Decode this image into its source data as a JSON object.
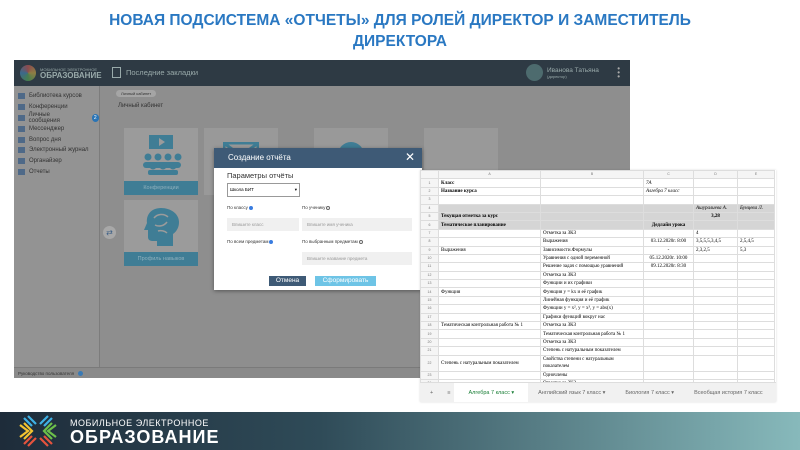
{
  "slide_title": [
    "НОВАЯ ПОДСИСТЕМА «ОТЧЕТЫ» ДЛЯ РОЛЕЙ ДИРЕКТОР И ЗАМЕСТИТЕЛЬ",
    "ДИРЕКТОРА"
  ],
  "app": {
    "logo": {
      "line1": "МОБИЛЬНОЕ ЭЛЕКТРОННОЕ",
      "line2": "ОБРАЗОВАНИЕ"
    },
    "bookmarks": "Последние закладки",
    "user": {
      "name": "Иванова Татьяна",
      "role": "(директор)"
    },
    "sidebar": [
      {
        "label": "Библиотека курсов"
      },
      {
        "label": "Конференции"
      },
      {
        "label": "Личные сообщения",
        "badge": "2"
      },
      {
        "label": "Мессенджер"
      },
      {
        "label": "Вопрос дня"
      },
      {
        "label": "Электронный журнал"
      },
      {
        "label": "Органайзер"
      },
      {
        "label": "Отчеты"
      }
    ],
    "breadcrumb": "Личный кабинет",
    "page_title": "Личный кабинет",
    "cards": [
      "Конференции",
      "Профиль навыков"
    ],
    "footer": "Руководство пользователя"
  },
  "modal": {
    "title": "Создание отчёта",
    "close": "✕",
    "params_label": "Параметры отчёты",
    "school_select": "Школа БИТ",
    "by_class": "По классу",
    "by_student": "По ученику",
    "class_placeholder": "Впишите класс",
    "student_placeholder": "Впишите имя ученика",
    "all_subjects": "По всем предметам",
    "selected_subjects": "По выбранным предметам",
    "subject_placeholder": "Впишите название предмета",
    "cancel": "Отмена",
    "submit": "Сформировать"
  },
  "sheet": {
    "columns": [
      "A",
      "B",
      "C",
      "D",
      "E"
    ],
    "rows": [
      {
        "n": "1",
        "cells": [
          "Класс",
          "",
          "7А",
          "",
          ""
        ]
      },
      {
        "n": "2",
        "cells": [
          "Название курса",
          "",
          "Алгебра 7 класс",
          "",
          ""
        ]
      },
      {
        "n": "3",
        "cells": [
          "",
          "",
          "",
          "",
          ""
        ]
      },
      {
        "n": "4",
        "cells": [
          "",
          "",
          "",
          "Ашуралиева А.",
          "Бунцева Л."
        ],
        "gray": true
      },
      {
        "n": "5",
        "cells": [
          "Текущая отметка за курс",
          "",
          "",
          "3,28",
          ""
        ],
        "gray": true
      },
      {
        "n": "6",
        "cells": [
          "Тематическое планирование",
          "",
          "Дедлайн урока",
          "",
          ""
        ],
        "gray": true
      },
      {
        "n": "7",
        "cells": [
          "",
          "Отметка за ЗКЗ",
          "",
          "4",
          ""
        ]
      },
      {
        "n": "8",
        "cells": [
          "",
          "Выражения",
          "03.12.2020г. 8:00",
          "3,5,5,5,3,4,5",
          "2,5,4,5"
        ]
      },
      {
        "n": "9",
        "cells": [
          "Выражения",
          "Зависимости.Формулы",
          "-",
          "2,3,2,5",
          "5,3"
        ]
      },
      {
        "n": "10",
        "cells": [
          "",
          "Уравнения с одной переменной",
          "05.12.2020г. 10:00",
          "",
          ""
        ]
      },
      {
        "n": "11",
        "cells": [
          "",
          "Решение задач с помощью уравнений",
          "09.12.2020г. 8:30",
          "",
          ""
        ]
      },
      {
        "n": "12",
        "cells": [
          "",
          "Отметка за ЗКЗ",
          "",
          "",
          ""
        ]
      },
      {
        "n": "13",
        "cells": [
          "",
          "Функции и их графики",
          "",
          "",
          ""
        ]
      },
      {
        "n": "14",
        "cells": [
          "Функция",
          "Функция y = kx и её график",
          "",
          "",
          ""
        ]
      },
      {
        "n": "15",
        "cells": [
          "",
          "Линейная функция и её график",
          "",
          "",
          ""
        ]
      },
      {
        "n": "16",
        "cells": [
          "",
          "Функции y = x², y = x³, y = abs(x)",
          "",
          "",
          ""
        ]
      },
      {
        "n": "17",
        "cells": [
          "",
          "Графики функций вокруг нас",
          "",
          "",
          ""
        ]
      },
      {
        "n": "18",
        "cells": [
          "Тематическая контрольная работа  № 1",
          "Отметка за ЗКЗ",
          "",
          "",
          ""
        ]
      },
      {
        "n": "19",
        "cells": [
          "",
          "Тематическая контрольная работа № 1",
          "",
          "",
          ""
        ]
      },
      {
        "n": "20",
        "cells": [
          "",
          "Отметка за ЗКЗ",
          "",
          "",
          ""
        ]
      },
      {
        "n": "21",
        "cells": [
          "",
          "Степень с натуральным показателем",
          "",
          "",
          ""
        ]
      },
      {
        "n": "22",
        "cells": [
          "Степень с натуральным показателем",
          "Свойства степени с натуральным показателем",
          "",
          "",
          ""
        ]
      },
      {
        "n": "23",
        "cells": [
          "",
          "Одночлены",
          "",
          "",
          ""
        ]
      },
      {
        "n": "24",
        "cells": [
          "",
          "Отметка за ЗКЗ",
          "",
          "",
          ""
        ]
      }
    ],
    "tabs": [
      "Алгебра 7 класс",
      "Английский язык 7 класс",
      "Биология 7 класс",
      "Всеобщая история 7 класс"
    ],
    "add_sheet": "+",
    "all_sheets": "≡"
  },
  "banner": {
    "line1": "МОБИЛЬНОЕ ЭЛЕКТРОННОЕ",
    "line2": "ОБРАЗОВАНИЕ"
  }
}
